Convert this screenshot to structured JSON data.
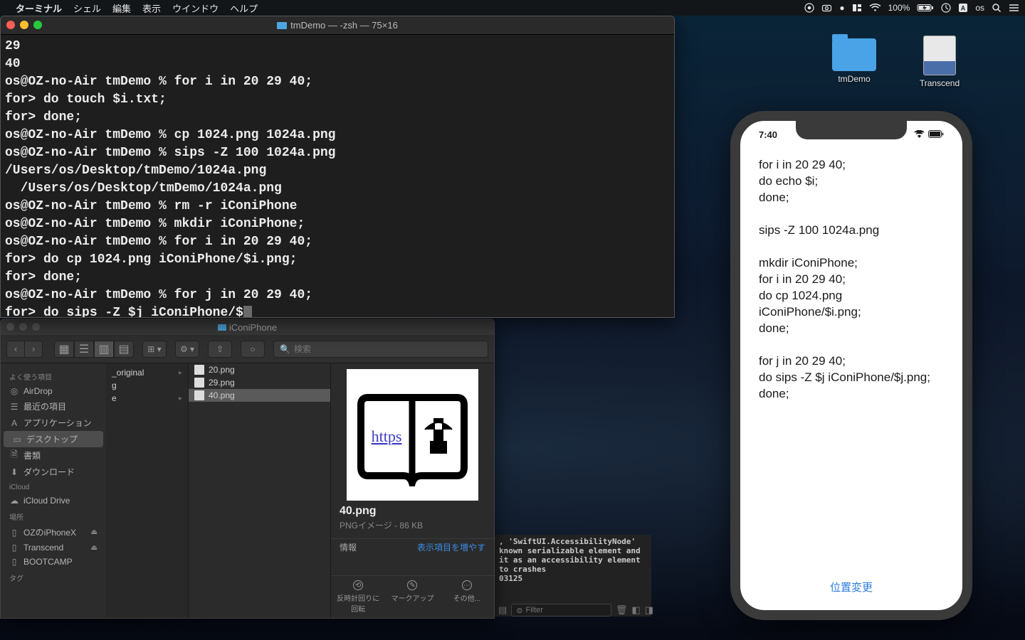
{
  "menubar": {
    "app": "ターミナル",
    "menus": [
      "シェル",
      "編集",
      "表示",
      "ウインドウ",
      "ヘルプ"
    ],
    "battery_pct": "100%",
    "user": "os"
  },
  "desktop": {
    "folder": "tmDemo",
    "drive": "Transcend"
  },
  "terminal": {
    "title": "tmDemo — -zsh — 75×16",
    "lines": [
      "29",
      "40",
      "os@OZ-no-Air tmDemo % for i in 20 29 40;",
      "for> do touch $i.txt;",
      "for> done;",
      "os@OZ-no-Air tmDemo % cp 1024.png 1024a.png",
      "os@OZ-no-Air tmDemo % sips -Z 100 1024a.png",
      "/Users/os/Desktop/tmDemo/1024a.png",
      "  /Users/os/Desktop/tmDemo/1024a.png",
      "os@OZ-no-Air tmDemo % rm -r iConiPhone",
      "os@OZ-no-Air tmDemo % mkdir iConiPhone;",
      "os@OZ-no-Air tmDemo % for i in 20 29 40;",
      "for> do cp 1024.png iConiPhone/$i.png;",
      "for> done;",
      "os@OZ-no-Air tmDemo % for j in 20 29 40;",
      "for> do sips -Z $j iConiPhone/$"
    ]
  },
  "finder": {
    "title": "iConiPhone",
    "search_placeholder": "検索",
    "sidebar": {
      "favorites_head": "よく使う項目",
      "favorites": [
        "AirDrop",
        "最近の項目",
        "アプリケーション",
        "デスクトップ",
        "書類",
        "ダウンロード"
      ],
      "icloud_head": "iCloud",
      "icloud": [
        "iCloud Drive"
      ],
      "locations_head": "場所",
      "locations": [
        "OZのiPhoneX",
        "Transcend",
        "BOOTCAMP"
      ],
      "tags_head": "タグ"
    },
    "col1": [
      "_original",
      "g",
      "e"
    ],
    "col2": [
      "20.png",
      "29.png",
      "40.png"
    ],
    "col2_selected": 2,
    "preview": {
      "name": "40.png",
      "subtitle": "PNGイメージ - 86 KB",
      "info_label": "情報",
      "more_label": "表示項目を増やす",
      "book_text": "https",
      "actions": [
        "反時計回りに\n回転",
        "マークアップ",
        "その他..."
      ]
    }
  },
  "xcode": {
    "body": ", 'SwiftUI.AccessibilityNode'\nknown serializable element and\nit as an accessibility element\nto crashes\n03125",
    "filter_placeholder": "Filter"
  },
  "phone": {
    "time": "7:40",
    "content": "for i in 20 29 40;\ndo echo $i;\ndone;\n\nsips -Z 100 1024a.png\n\nmkdir iConiPhone;\nfor i in 20 29 40;\ndo cp 1024.png iConiPhone/$i.png;\ndone;\n\nfor j in 20 29 40;\ndo sips -Z $j iConiPhone/$j.png;\ndone;",
    "bottom_btn": "位置変更"
  }
}
